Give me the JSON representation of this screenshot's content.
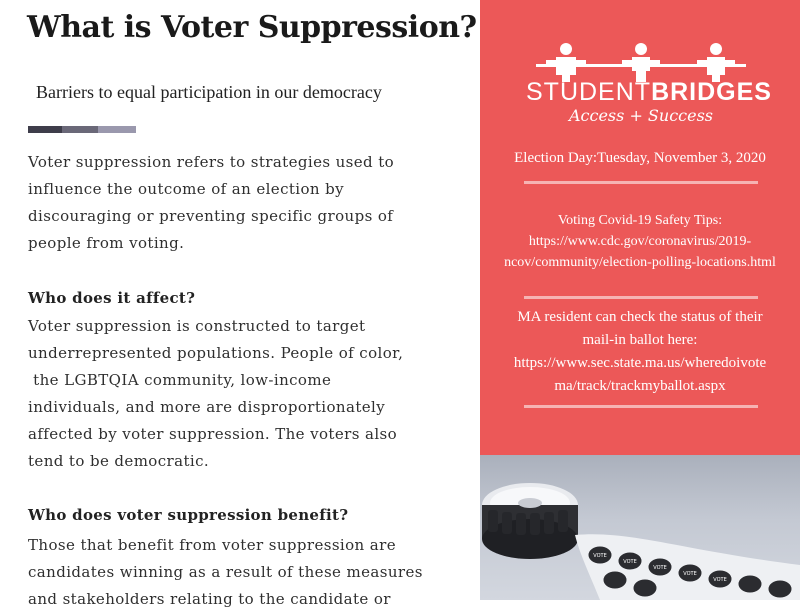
{
  "document": {
    "title": "What is Voter Suppression?",
    "subtitle": "Barriers to equal participation in our democracy",
    "divider_colors": [
      "#3e3d4a",
      "#6a6878",
      "#9a98ad"
    ],
    "intro_lines": [
      "Voter suppression refers to strategies used to",
      "influence the outcome of an election by",
      "discouraging or preventing specific groups of",
      "people from voting."
    ],
    "sections": [
      {
        "heading": "Who does it affect?",
        "lines": [
          "Voter suppression is constructed to target",
          "underrepresented populations. People of color,",
          " the LGBTQIA community, low-income",
          "individuals, and more are disproportionately",
          "affected by voter suppression. The voters also",
          "tend to be democratic."
        ]
      },
      {
        "heading": "Who does voter suppression benefit?",
        "lines": [
          "Those that benefit from voter suppression are",
          "candidates winning as a result of these measures",
          "and stakeholders relating to the candidate or"
        ]
      }
    ]
  },
  "sidebar": {
    "background": "#ec5858",
    "logo": {
      "word_regular": "STUDENT",
      "word_bold": "BRIDGES",
      "tagline": "Access + Success"
    },
    "election_day": "Election Day:Tuesday, November 3, 2020",
    "safety": {
      "lines": [
        "Voting Covid-19 Safety Tips:",
        "https://www.cdc.gov/coronavirus/2019-",
        "ncov/community/election-polling-locations.html"
      ]
    },
    "ballot": {
      "lines": [
        "MA resident can check the status of their",
        "mail-in ballot here:",
        "https://www.sec.state.ma.us/wheredoivote",
        "ma/track/trackmyballot.aspx"
      ]
    }
  },
  "photo": {
    "subject": "roll of I Voted stickers",
    "sticker_text": "VOTE"
  }
}
